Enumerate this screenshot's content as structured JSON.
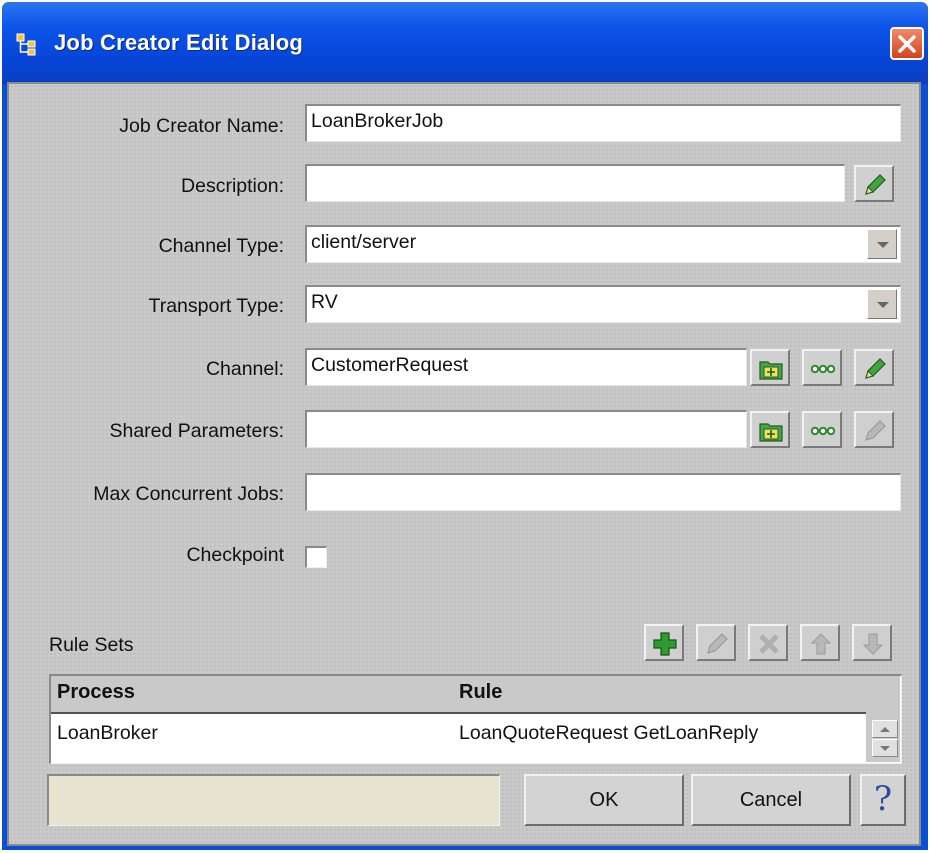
{
  "window": {
    "title": "Job Creator Edit Dialog"
  },
  "form": {
    "job_creator_name": {
      "label": "Job Creator Name:",
      "value": "LoanBrokerJob"
    },
    "description": {
      "label": "Description:",
      "value": ""
    },
    "channel_type": {
      "label": "Channel Type:",
      "value": "client/server"
    },
    "transport_type": {
      "label": "Transport Type:",
      "value": "RV"
    },
    "channel": {
      "label": "Channel:",
      "value": "CustomerRequest"
    },
    "shared_parameters": {
      "label": "Shared Parameters:",
      "value": ""
    },
    "max_concurrent_jobs": {
      "label": "Max Concurrent Jobs:",
      "value": ""
    },
    "checkpoint": {
      "label": "Checkpoint",
      "checked": false
    }
  },
  "rule_sets": {
    "label": "Rule Sets",
    "columns": [
      "Process",
      "Rule"
    ],
    "rows": [
      {
        "process": "LoanBroker",
        "rule": "LoanQuoteRequest GetLoanReply"
      }
    ]
  },
  "buttons": {
    "ok": "OK",
    "cancel": "Cancel",
    "help_icon": "?"
  },
  "icons": {
    "app": "job-creator-icon",
    "edit": "pencil-icon",
    "browse": "folder-icon",
    "select": "ellipsis-icon",
    "add": "plus-icon",
    "delete": "x-icon",
    "up": "arrow-up-icon",
    "down": "arrow-down-icon"
  },
  "colors": {
    "title_bar": "#0c55e8",
    "close_button": "#d4431c",
    "pencil": "#3fa63f",
    "status_field": "#e6e3cf"
  }
}
